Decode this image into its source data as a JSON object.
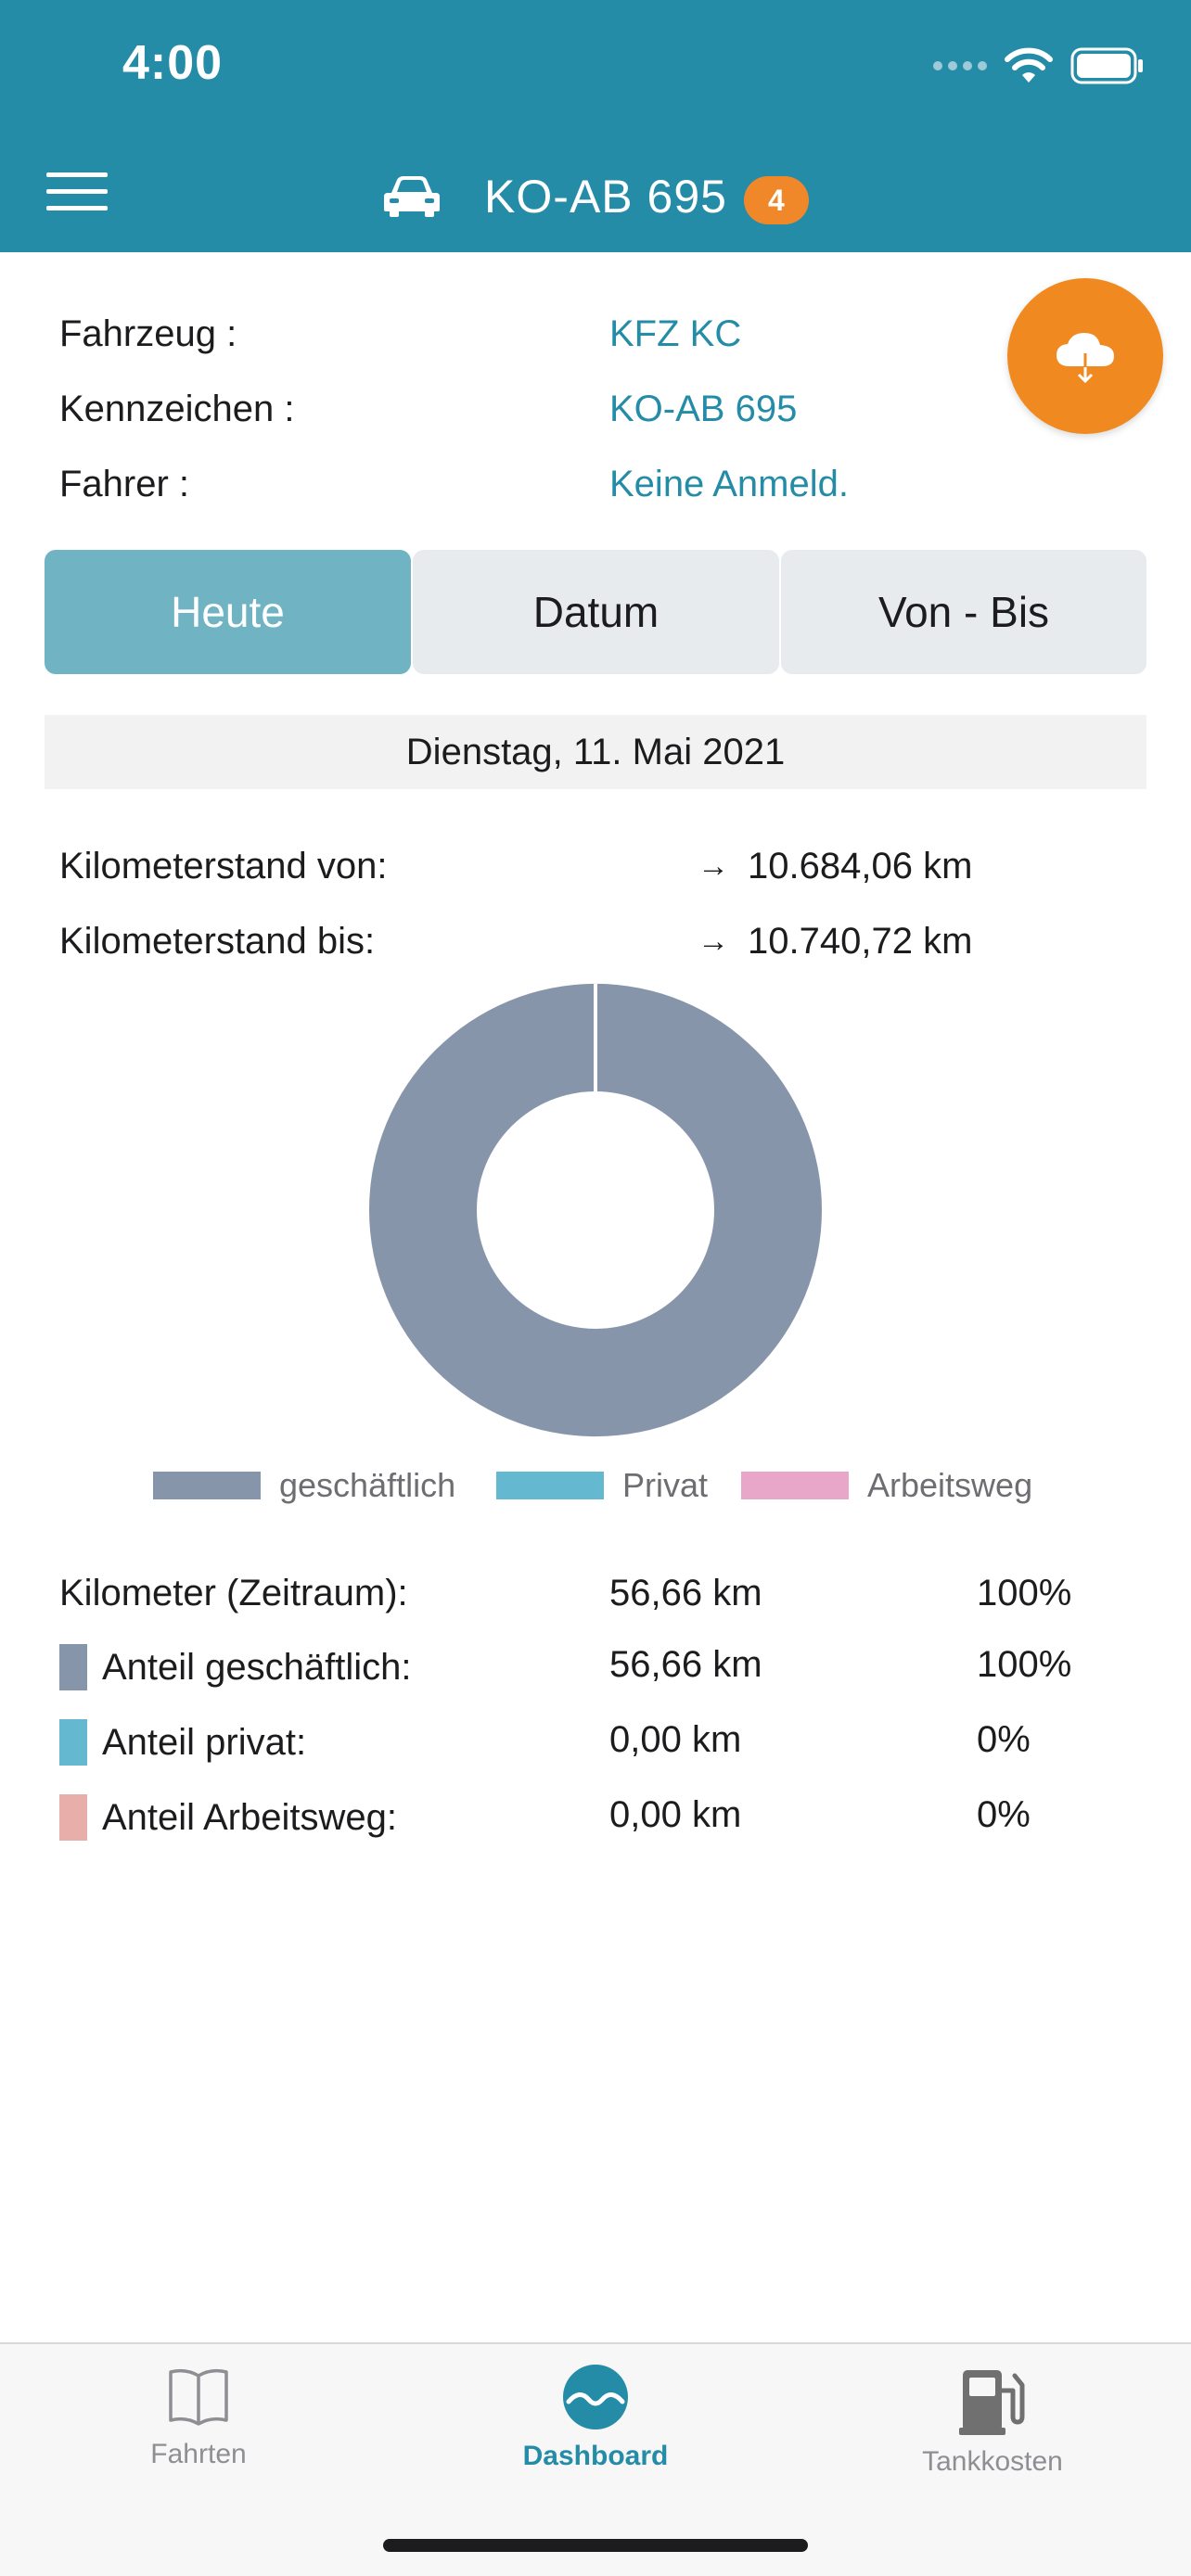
{
  "status_bar": {
    "time": "4:00"
  },
  "header": {
    "title": "KO-AB 695",
    "badge": "4"
  },
  "vehicle_info": {
    "rows": [
      {
        "label": "Fahrzeug :",
        "value": "KFZ KC"
      },
      {
        "label": "Kennzeichen :",
        "value": "KO-AB 695"
      },
      {
        "label": "Fahrer :",
        "value": "Keine Anmeld."
      }
    ]
  },
  "segments": [
    {
      "label": "Heute",
      "active": true
    },
    {
      "label": "Datum",
      "active": false
    },
    {
      "label": "Von - Bis",
      "active": false
    }
  ],
  "date_label": "Dienstag, 11. Mai 2021",
  "odometer": {
    "from_label": "Kilometerstand von:",
    "from_value": "10.684,06 km",
    "to_label": "Kilometerstand bis:",
    "to_value": "10.740,72 km",
    "arrow": "→"
  },
  "chart_data": {
    "type": "pie",
    "donut": true,
    "categories": [
      "geschäftlich",
      "Privat",
      "Arbeitsweg"
    ],
    "values": [
      56.66,
      0.0,
      0.0
    ],
    "colors": [
      "#8795ab",
      "#64b8d0",
      "#e8a6c8"
    ],
    "legend_position": "bottom"
  },
  "summary": {
    "total": {
      "label": "Kilometer (Zeitraum):",
      "km": "56,66 km",
      "pct": "100%"
    },
    "rows": [
      {
        "label": "Anteil geschäftlich:",
        "km": "56,66 km",
        "pct": "100%",
        "color": "#8795ab"
      },
      {
        "label": "Anteil privat:",
        "km": "0,00 km",
        "pct": "0%",
        "color": "#64b8d0"
      },
      {
        "label": "Anteil Arbeitsweg:",
        "km": "0,00 km",
        "pct": "0%",
        "color": "#e8afaa"
      }
    ]
  },
  "tabbar": {
    "items": [
      {
        "label": "Fahrten",
        "icon": "book-icon",
        "active": false
      },
      {
        "label": "Dashboard",
        "icon": "dashboard-icon",
        "active": true
      },
      {
        "label": "Tankkosten",
        "icon": "fuel-pump-icon",
        "active": false
      }
    ]
  },
  "colors": {
    "primary": "#258ca8",
    "accent": "#f08a20"
  }
}
